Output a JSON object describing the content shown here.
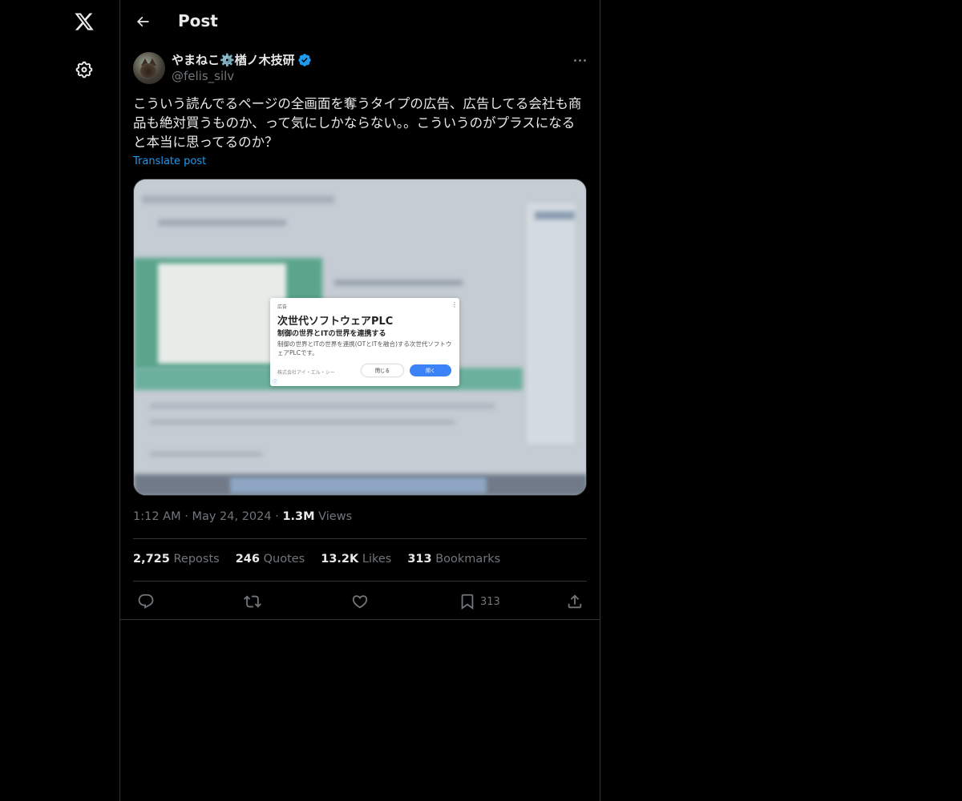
{
  "nav": {
    "logo_icon": "x-logo-icon",
    "settings_icon": "gear-icon"
  },
  "header": {
    "title": "Post",
    "back_icon": "arrow-left-icon"
  },
  "post": {
    "author": {
      "display_name": "やまねこ⚙️楢ノ木技研",
      "handle": "@felis_silv",
      "verified": true
    },
    "text": "こういう読んでるページの全画面を奪うタイプの広告、広告してる会社も商品も絶対買うものか、って気にしかならない。。こういうのがプラスになると本当に思ってるのか？",
    "translate_label": "Translate post",
    "media": {
      "ad": {
        "label": "広告",
        "title": "次世代ソフトウェアPLC",
        "subtitle": "制御の世界とITの世界を連携する",
        "description": "制御の世界とITの世界を連携(OTとITを融合)する次世代ソフトウェアPLCです。",
        "company": "株式会社アイ・エル・シー",
        "close_label": "閉じる",
        "open_label": "開く"
      }
    },
    "time": "1:12 AM",
    "date": "May 24, 2024",
    "views_count": "1.3M",
    "views_label": "Views",
    "stats": {
      "reposts_count": "2,725",
      "reposts_label": "Reposts",
      "quotes_count": "246",
      "quotes_label": "Quotes",
      "likes_count": "13.2K",
      "likes_label": "Likes",
      "bookmarks_count": "313",
      "bookmarks_label": "Bookmarks"
    },
    "actions": {
      "bookmark_count": "313"
    }
  },
  "colors": {
    "background": "#000000",
    "text": "#e7e9ea",
    "secondary": "#71767b",
    "accent": "#1d9bf0",
    "border": "#2f3336"
  }
}
